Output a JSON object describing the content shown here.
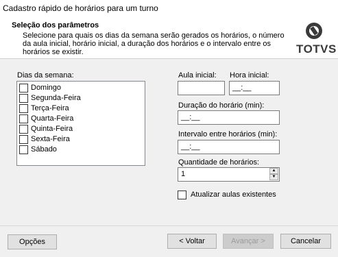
{
  "window": {
    "title": "Cadastro rápido de horários para um turno"
  },
  "header": {
    "title": "Seleção dos parâmetros",
    "description": "Selecione para quais os dias da semana serão gerados os horários, o número da aula inicial, horário inicial, a duração dos horários e o intervalo entre os horários se existir.",
    "logo_text": "TOTVS"
  },
  "days": {
    "label": "Dias da semana:",
    "items": [
      {
        "label": "Domingo",
        "checked": false
      },
      {
        "label": "Segunda-Feira",
        "checked": false
      },
      {
        "label": "Terça-Feira",
        "checked": false
      },
      {
        "label": "Quarta-Feira",
        "checked": false
      },
      {
        "label": "Quinta-Feira",
        "checked": false
      },
      {
        "label": "Sexta-Feira",
        "checked": false
      },
      {
        "label": "Sábado",
        "checked": false
      }
    ]
  },
  "form": {
    "aula_inicial_label": "Aula inicial:",
    "aula_inicial_value": "",
    "hora_inicial_label": "Hora inicial:",
    "hora_inicial_value": "__:__",
    "duracao_label": "Duração do horário (min):",
    "duracao_value": "__:__",
    "intervalo_label": "Intervalo entre horários (min):",
    "intervalo_value": "__:__",
    "quantidade_label": "Quantidade de horários:",
    "quantidade_value": "1",
    "atualizar_label": "Atualizar aulas existentes",
    "atualizar_checked": false
  },
  "buttons": {
    "opcoes": "Opções",
    "voltar": "< Voltar",
    "avancar": "Avançar >",
    "cancelar": "Cancelar"
  },
  "icons": {
    "spin_up": "spin-up-arrow-icon",
    "spin_down": "spin-down-arrow-icon",
    "logo": "totvs-logo-icon"
  }
}
